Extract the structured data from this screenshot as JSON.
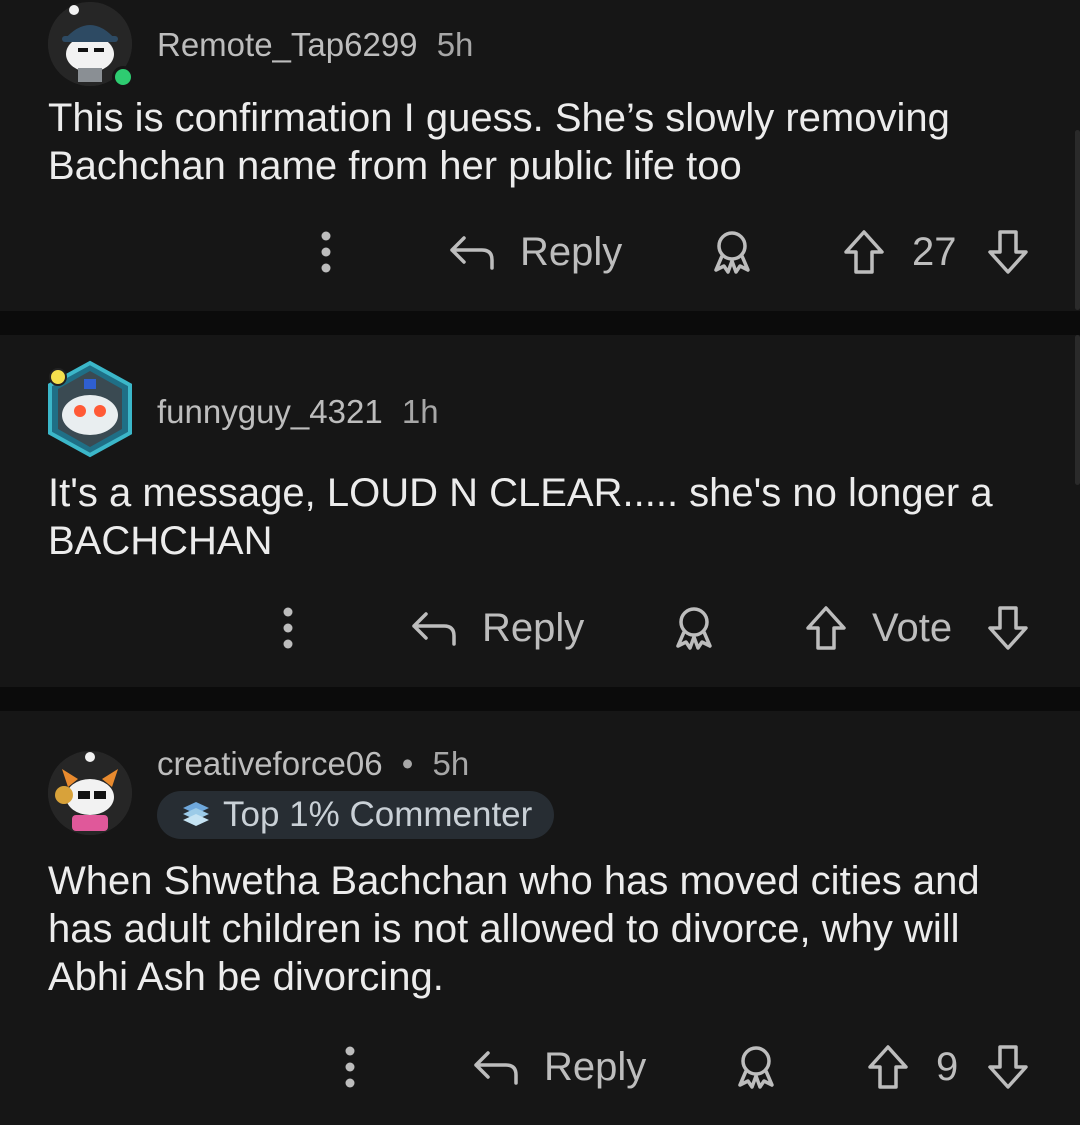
{
  "comments": [
    {
      "username": "Remote_Tap6299",
      "time": "5h",
      "text": "This is confirmation I guess. She’s slowly removing Bachchan name from her public life too",
      "reply_label": "Reply",
      "vote_count": "27",
      "online": true
    },
    {
      "username": "funnyguy_4321",
      "time": "1h",
      "text": "It's a message, LOUD N CLEAR..... she's no longer a BACHCHAN",
      "reply_label": "Reply",
      "vote_count": "Vote"
    },
    {
      "username": "creativeforce06",
      "separator": "•",
      "time": "5h",
      "badge": "Top 1% Commenter",
      "text": "When Shwetha Bachchan who has moved cities and has adult children is not allowed to divorce, why will Abhi Ash be divorcing.",
      "reply_label": "Reply",
      "vote_count": "9"
    }
  ],
  "colors": {
    "background": "#0b0b0b",
    "card": "#161616",
    "text": "#ececec",
    "muted": "#a7a7a7",
    "online": "#2ecc71"
  },
  "icons": [
    "more-vertical-icon",
    "reply-arrow-icon",
    "award-icon",
    "upvote-arrow-icon",
    "downvote-arrow-icon"
  ]
}
